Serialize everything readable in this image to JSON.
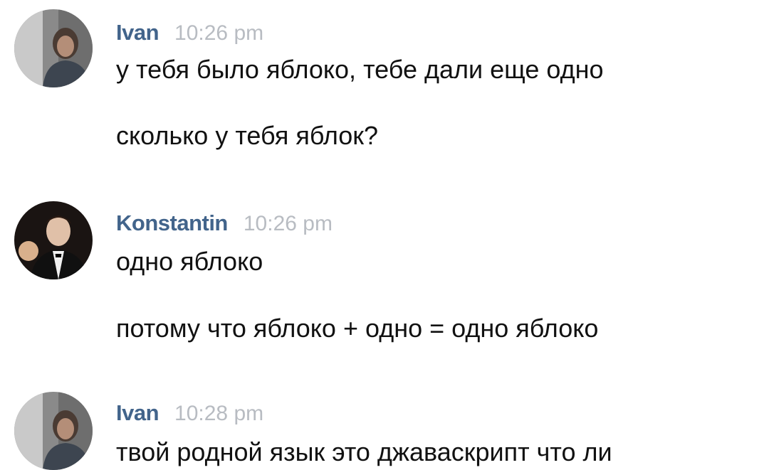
{
  "messages": [
    {
      "author": "Ivan",
      "time": "10:26 pm",
      "avatar": "ivan-avatar",
      "lines": [
        "у тебя было яблоко, тебе дали еще одно",
        "сколько у тебя яблок?"
      ]
    },
    {
      "author": "Konstantin",
      "time": "10:26 pm",
      "avatar": "konstantin-avatar",
      "lines": [
        "одно яблоко",
        "потому что яблоко + одно = одно яблоко"
      ]
    },
    {
      "author": "Ivan",
      "time": "10:28 pm",
      "avatar": "ivan-avatar",
      "lines": [
        "твой родной язык это джаваскрипт что ли"
      ]
    }
  ],
  "colors": {
    "author": "#42648b",
    "time": "#b8bcc2",
    "text": "#111111",
    "background": "#ffffff"
  }
}
